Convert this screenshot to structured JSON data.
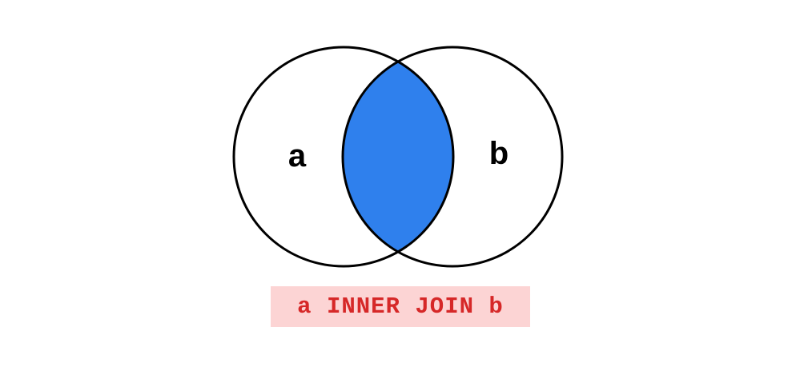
{
  "diagram": {
    "left_set_label": "a",
    "right_set_label": "b",
    "intersection_color": "#2f80ed",
    "circle_fill": "#ffffff",
    "circle_stroke": "#000000"
  },
  "caption": {
    "text": "a INNER JOIN b",
    "text_color": "#d62828",
    "background_color": "#fcd4d4"
  }
}
